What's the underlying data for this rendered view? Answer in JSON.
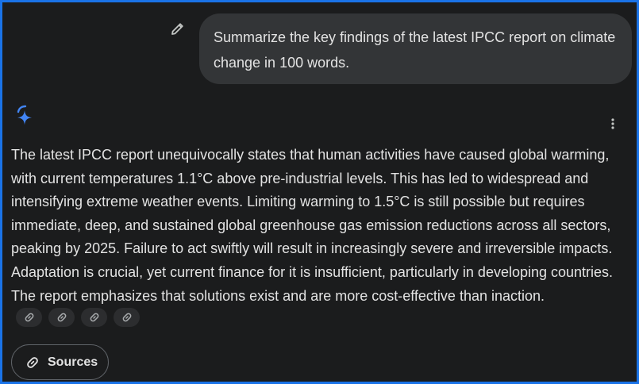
{
  "user_message": {
    "text": "Summarize the key findings of the latest IPCC report on climate change in 100 words."
  },
  "response": {
    "text": "The latest IPCC report unequivocally states that human activities have caused global warming, with current temperatures 1.1°C above pre-industrial levels. This has led to widespread and intensifying extreme weather events. Limiting warming to 1.5°C is still possible but requires immediate, deep, and sustained global greenhouse gas emission reductions across all sectors, peaking by 2025. Failure to act swiftly will result in increasingly severe and irreversible impacts. Adaptation is crucial, yet current finance for it is insufficient, particularly in developing countries. The report emphasizes that solutions exist and are more cost-effective than inaction."
  },
  "citation_chips": [
    {
      "icon": "link-icon"
    },
    {
      "icon": "link-icon"
    },
    {
      "icon": "link-icon"
    },
    {
      "icon": "link-icon"
    }
  ],
  "sources": {
    "label": "Sources",
    "icon": "link-icon"
  },
  "icons": {
    "edit": "pencil-icon",
    "assistant": "gemini-sparkle-icon",
    "more": "more-vert-icon"
  },
  "colors": {
    "background": "#1b1c1d",
    "frame_border": "#1a73e8",
    "user_bubble": "#333537",
    "text": "#e3e3e3",
    "sparkle_blue": "#4285f4"
  }
}
